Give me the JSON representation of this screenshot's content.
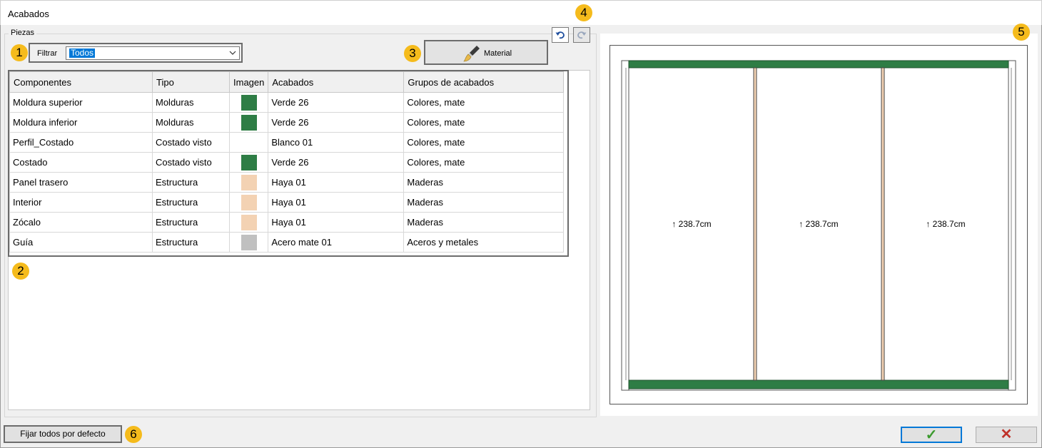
{
  "window": {
    "title": "Acabados"
  },
  "pieces": {
    "group_label": "Piezas",
    "filter_label": "Filtrar",
    "filter_value": "Todos",
    "material_button": "Material",
    "columns": [
      "Componentes",
      "Tipo",
      "Imagen",
      "Acabados",
      "Grupos de acabados"
    ],
    "rows": [
      {
        "component": "Moldura superior",
        "type": "Molduras",
        "swatch": "#2e7d45",
        "finish": "Verde 26",
        "group": "Colores, mate"
      },
      {
        "component": "Moldura inferior",
        "type": "Molduras",
        "swatch": "#2e7d45",
        "finish": "Verde 26",
        "group": "Colores, mate"
      },
      {
        "component": "Perfil_Costado",
        "type": "Costado visto",
        "swatch": "#ffffff",
        "finish": "Blanco 01",
        "group": "Colores, mate"
      },
      {
        "component": "Costado",
        "type": "Costado visto",
        "swatch": "#2e7d45",
        "finish": "Verde 26",
        "group": "Colores, mate"
      },
      {
        "component": "Panel trasero",
        "type": "Estructura",
        "swatch": "#f3d2b3",
        "finish": "Haya 01",
        "group": "Maderas"
      },
      {
        "component": "Interior",
        "type": "Estructura",
        "swatch": "#f3d2b3",
        "finish": "Haya 01",
        "group": "Maderas"
      },
      {
        "component": "Zócalo",
        "type": "Estructura",
        "swatch": "#f3d2b3",
        "finish": "Haya 01",
        "group": "Maderas"
      },
      {
        "component": "Guía",
        "type": "Estructura",
        "swatch": "#c0c0c0",
        "finish": "Acero mate 01",
        "group": "Aceros y metales"
      }
    ]
  },
  "preview": {
    "dimension_labels": [
      "↑ 238.7cm",
      "↑ 238.7cm",
      "↑ 238.7cm"
    ],
    "colors": {
      "molding": "#2e7d45",
      "wood": "#f3d2b3"
    }
  },
  "footer": {
    "set_defaults_button": "Fijar todos por defecto",
    "ok_icon": "✓",
    "cancel_icon": "✕"
  },
  "badges": [
    "1",
    "2",
    "3",
    "4",
    "5",
    "6"
  ],
  "icons": {
    "undo": "undo-icon",
    "redo": "redo-icon",
    "brush": "paintbrush-icon"
  }
}
